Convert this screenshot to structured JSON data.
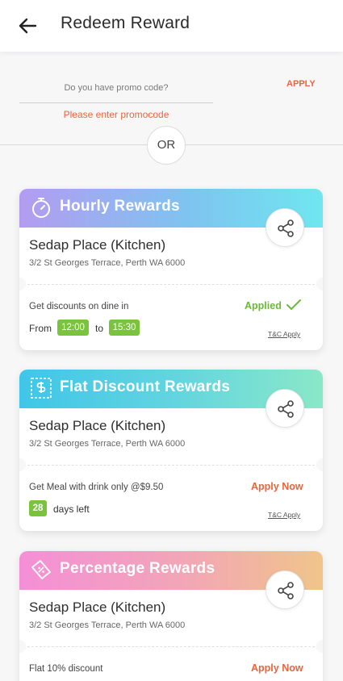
{
  "header": {
    "title": "Redeem Reward",
    "back_icon": "arrow-left-icon"
  },
  "promo": {
    "placeholder": "Do you have promo code?",
    "apply_label": "APPLY",
    "error": "Please enter promocode"
  },
  "separator": {
    "label": "OR"
  },
  "colors": {
    "accent": "#e8663d",
    "success": "#79c33d"
  },
  "rewards": [
    {
      "type_label": "Hourly Rewards",
      "icon": "stopwatch-icon",
      "place": "Sedap Place (Kitchen)",
      "address": "3/2 St Georges Terrace, Perth WA 6000",
      "offer": "Get discounts on dine in",
      "status": "Applied",
      "from_label": "From",
      "from_time": "12:00",
      "to_label": "to",
      "to_time": "15:30",
      "tc": "T&C Apply"
    },
    {
      "type_label": "Flat Discount Rewards",
      "icon": "dollar-tag-icon",
      "place": "Sedap Place (Kitchen)",
      "address": "3/2 St Georges Terrace, Perth WA 6000",
      "offer": "Get Meal with drink only @$9.50",
      "status": "Apply Now",
      "days": "28",
      "days_label": "days left",
      "tc": "T&C Apply"
    },
    {
      "type_label": "Percentage Rewards",
      "icon": "percent-ticket-icon",
      "place": "Sedap Place (Kitchen)",
      "address": "3/2 St Georges Terrace, Perth WA 6000",
      "offer": "Flat 10% discount",
      "status": "Apply Now"
    }
  ]
}
